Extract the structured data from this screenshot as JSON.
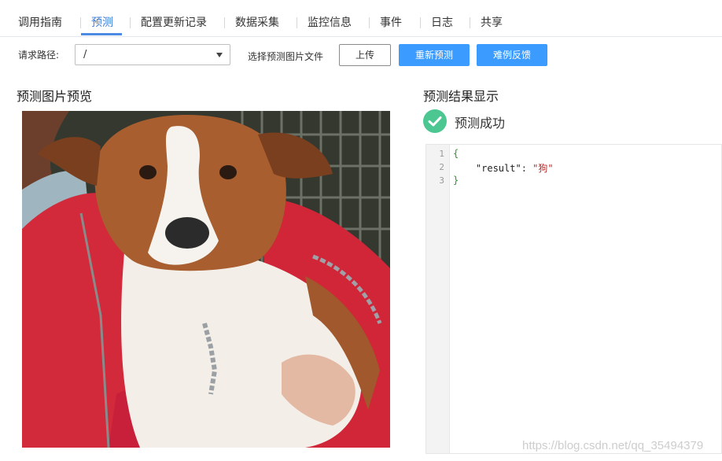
{
  "tabs": [
    {
      "label": "调用指南",
      "active": false
    },
    {
      "label": "预测",
      "active": true
    },
    {
      "label": "配置更新记录",
      "active": false
    },
    {
      "label": "数据采集",
      "active": false
    },
    {
      "label": "监控信息",
      "active": false
    },
    {
      "label": "事件",
      "active": false
    },
    {
      "label": "日志",
      "active": false
    },
    {
      "label": "共享",
      "active": false
    }
  ],
  "toolbar": {
    "path_label": "请求路径:",
    "path_value": "/",
    "file_label": "选择预测图片文件",
    "upload_label": "上传",
    "repredict_label": "重新预测",
    "feedback_label": "难例反馈"
  },
  "preview": {
    "title": "预测图片预览",
    "image_subject": "puppy-held-in-red-jacket"
  },
  "result": {
    "title": "预测结果显示",
    "status_text": "预测成功",
    "status_icon": "check-circle-icon",
    "status_color": "#4cc792",
    "lines": [
      {
        "num": "1",
        "text": "{"
      },
      {
        "num": "2",
        "key": "\"result\"",
        "sep": ": ",
        "value": "\"狗\""
      },
      {
        "num": "3",
        "text": "}"
      }
    ]
  },
  "colors": {
    "accent": "#3c9bff",
    "tab_active": "#3b7bd8"
  },
  "watermark": "https://blog.csdn.net/qq_35494379"
}
